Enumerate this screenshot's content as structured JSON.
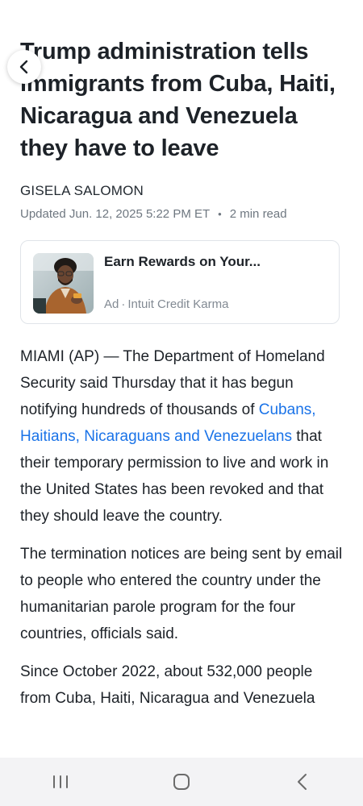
{
  "article": {
    "headline": "Trump administration tells immigrants from Cuba, Haiti, Nicaragua and Venezuela they have to leave",
    "author": "GISELA SALOMON",
    "updated": "Updated Jun. 12, 2025 5:22 PM ET",
    "meta_separator": "•",
    "read_time": "2 min read"
  },
  "ad": {
    "title": "Earn Rewards on Your...",
    "label": "Ad",
    "separator": "·",
    "sponsor": "Intuit Credit Karma"
  },
  "body": {
    "p1_before": "MIAMI (AP) — The Department of Homeland Security said Thursday that it has begun notifying hundreds of thousands of ",
    "p1_link": "Cubans, Haitians, Nicaraguans and Venezuelans",
    "p1_after": " that their temporary permission to live and work in the United States has been revoked and that they should leave the country.",
    "p2": "The termination notices are being sent by email to people who entered the country under the humanitarian parole program for the four countries, officials said.",
    "p3": "Since October 2022, about 532,000 people from Cuba, Haiti, Nicaragua and Venezuela"
  },
  "nav": {
    "buttons": [
      "recent-apps-icon",
      "home-icon",
      "back-icon"
    ]
  },
  "colors": {
    "link": "#1a73e8",
    "headline": "#1d2228",
    "meta": "#6e7780",
    "nav_background": "#f3f3f5"
  }
}
